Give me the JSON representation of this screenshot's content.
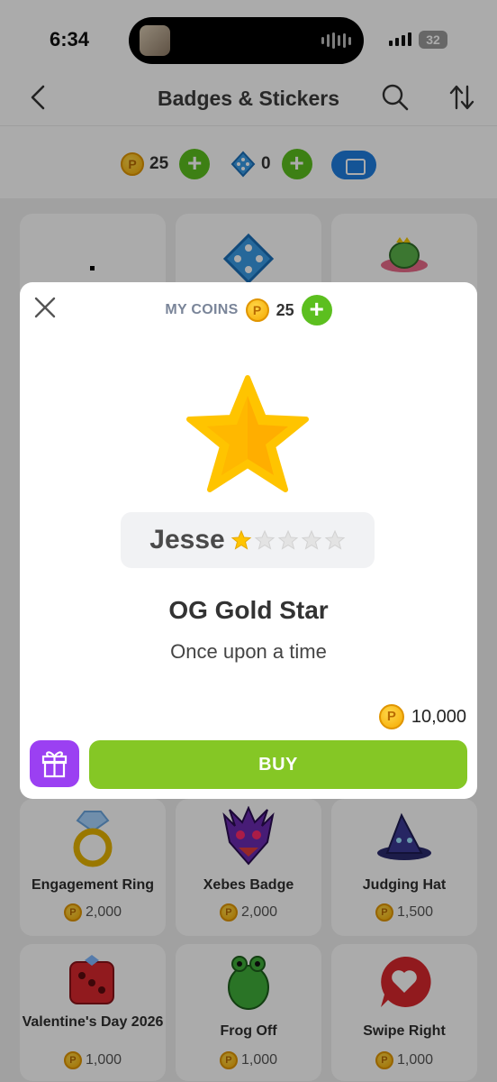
{
  "status_bar": {
    "time": "6:34",
    "battery": "32"
  },
  "header": {
    "title": "Badges & Stickers"
  },
  "currency": {
    "coins": "25",
    "dice": "0"
  },
  "coin_symbol": "P",
  "grid": {
    "items": [
      {
        "label": "Engagement Ring",
        "price": "2,000"
      },
      {
        "label": "Xebes Badge",
        "price": "2,000"
      },
      {
        "label": "Judging Hat",
        "price": "1,500"
      },
      {
        "label": "Valentine's Day 2026",
        "price": "1,000"
      },
      {
        "label": "Frog Off",
        "price": "1,000"
      },
      {
        "label": "Swipe Right",
        "price": "1,000"
      }
    ]
  },
  "modal": {
    "my_coins_label": "MY COINS",
    "my_coins_value": "25",
    "preview_name": "Jesse",
    "rating": 1,
    "rating_max": 5,
    "badge_name": "OG Gold Star",
    "badge_desc": "Once upon a time",
    "price": "10,000",
    "buy_label": "BUY"
  },
  "colors": {
    "accent_green": "#85c725",
    "plus_green": "#5cbf1f",
    "gift_purple": "#9b40f2",
    "wallet_blue": "#1f7ee0",
    "star_gold": "#ffc400"
  }
}
